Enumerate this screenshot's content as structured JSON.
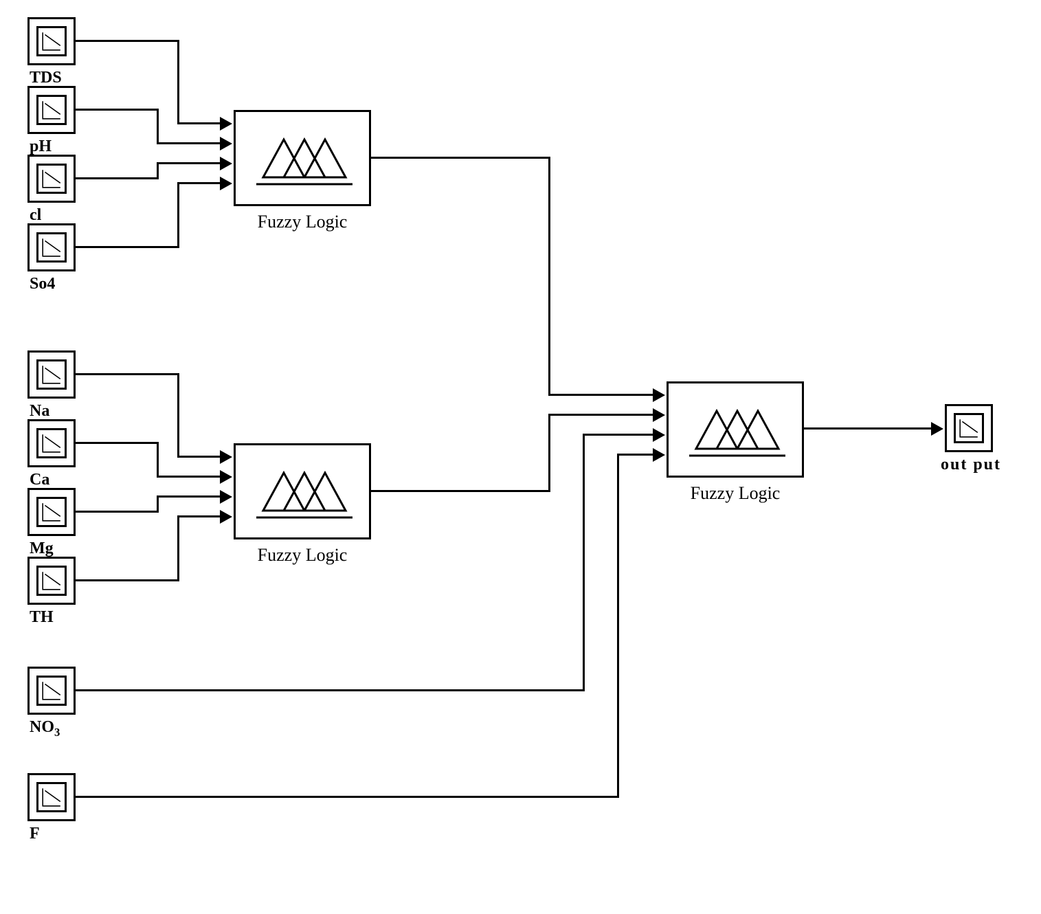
{
  "meta": {
    "description": "Simulink-style block diagram for hierarchical fuzzy logic system combining water quality parameters into a single output."
  },
  "sources": {
    "group1": [
      {
        "key": "tds",
        "label": "TDS"
      },
      {
        "key": "ph",
        "label": "pH"
      },
      {
        "key": "cl",
        "label": "cl"
      },
      {
        "key": "so4",
        "label": "So4"
      }
    ],
    "group2": [
      {
        "key": "na",
        "label": "Na"
      },
      {
        "key": "ca",
        "label": "Ca"
      },
      {
        "key": "mg",
        "label": "Mg"
      },
      {
        "key": "th",
        "label": "TH"
      }
    ],
    "direct": [
      {
        "key": "no3",
        "label_html": "NO<span class='sub'>3</span>"
      },
      {
        "key": "f",
        "label": "F"
      }
    ]
  },
  "blocks": {
    "fuzzy1": {
      "label": "Fuzzy Logic"
    },
    "fuzzy2": {
      "label": "Fuzzy Logic"
    },
    "fuzzy3": {
      "label": "Fuzzy Logic"
    }
  },
  "output": {
    "label": "out put",
    "type": "sink"
  }
}
